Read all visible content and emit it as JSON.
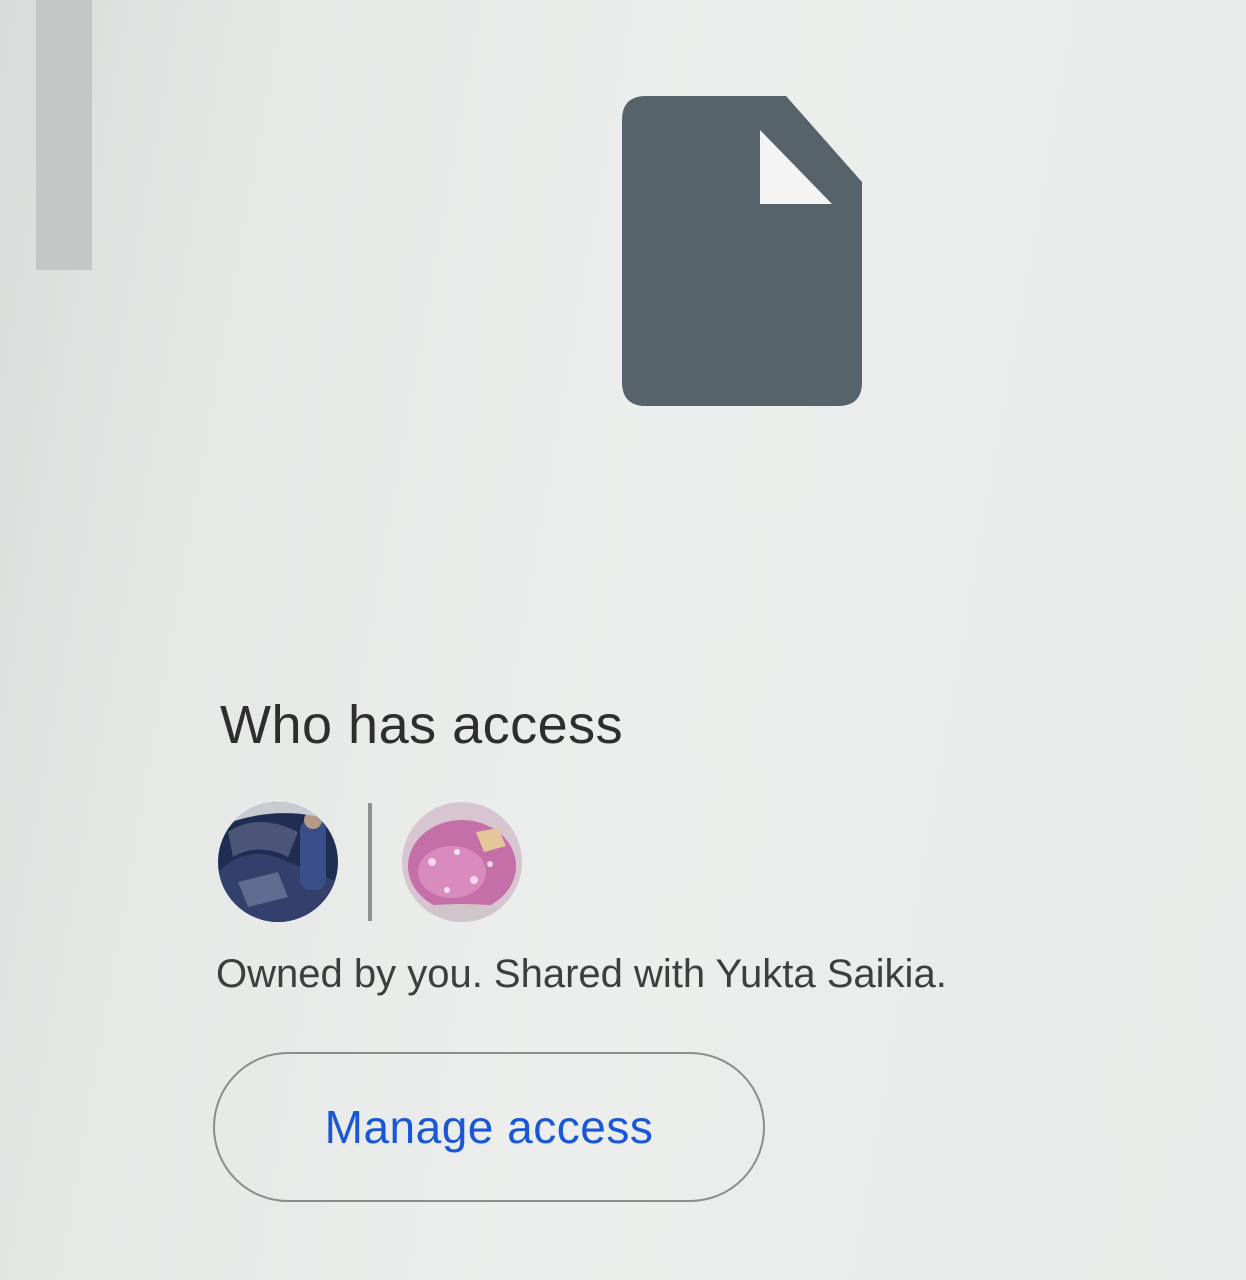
{
  "icons": {
    "file": "file-icon"
  },
  "access_section": {
    "heading": "Who has access",
    "avatars": [
      {
        "name": "owner-avatar"
      },
      {
        "name": "shared-user-avatar"
      }
    ],
    "description": "Owned by you. Shared with Yukta Saikia.",
    "manage_button_label": "Manage access"
  },
  "colors": {
    "file_icon": "#57636a",
    "button_text": "#1a57d6",
    "button_border": "#8b8d8c"
  }
}
